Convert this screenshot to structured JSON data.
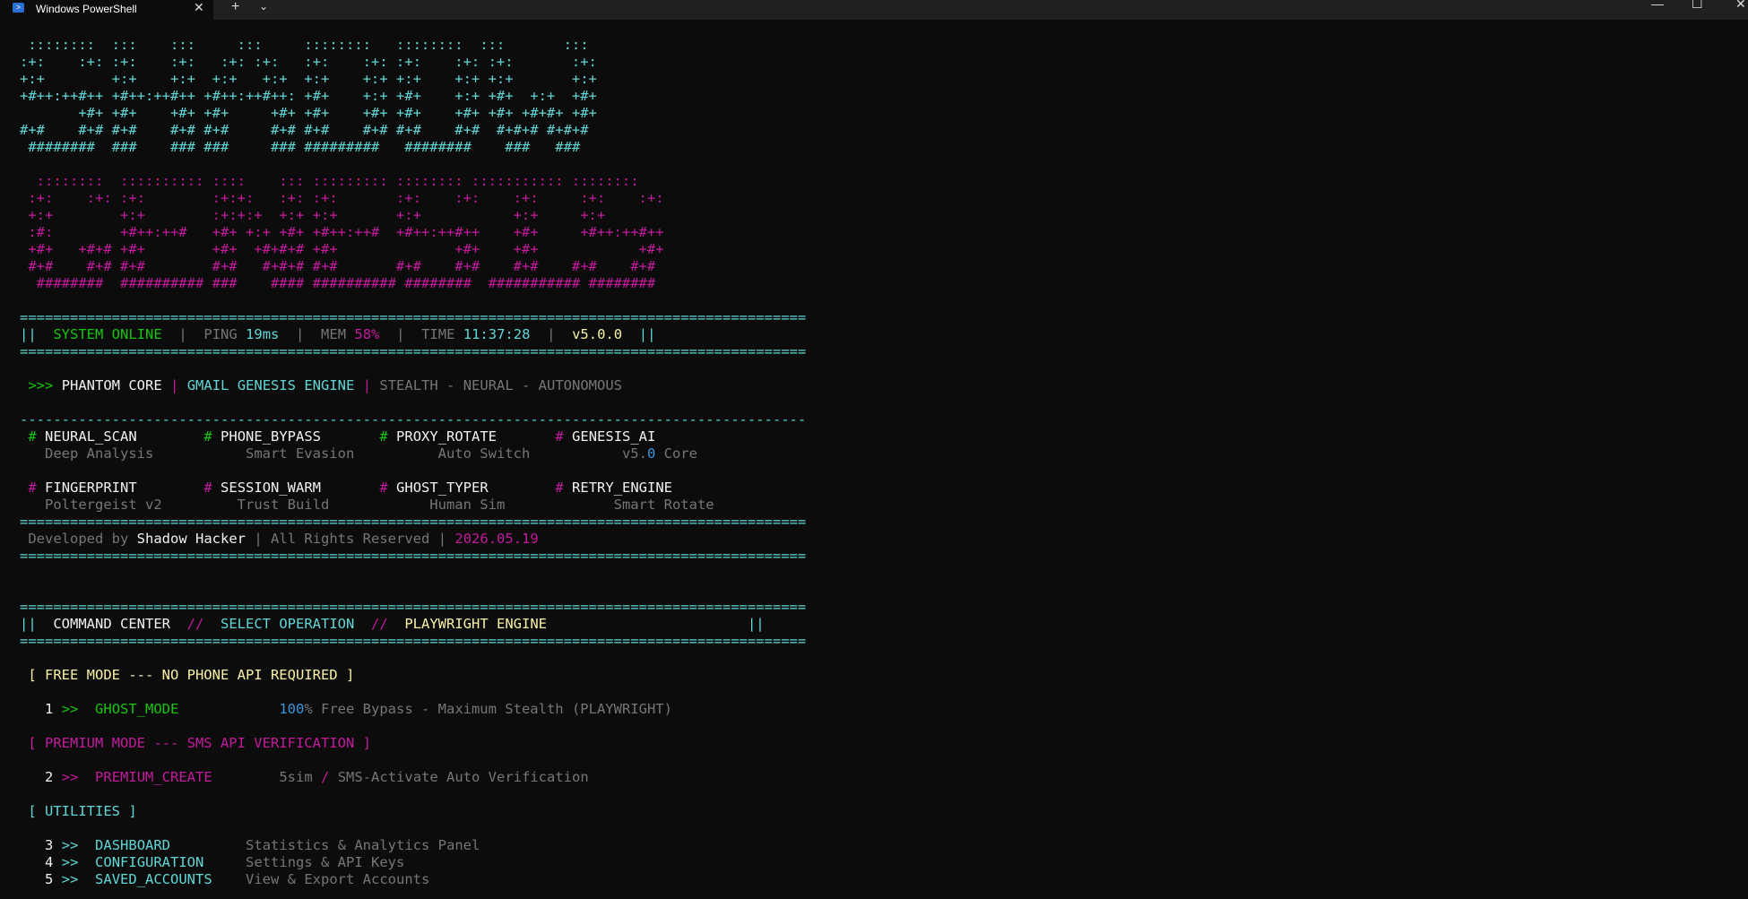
{
  "window": {
    "tab_title": "Windows PowerShell",
    "tab_close": "✕",
    "new_tab": "+",
    "tab_dropdown": "⌄",
    "minimize": "—",
    "maximize": "☐",
    "close": "✕"
  },
  "banner": {
    "ghost_lines": [
      " ::::::::  :::    :::     :::     ::::::::   ::::::::  :::       :::",
      ":+:    :+: :+:    :+:   :+: :+:   :+:    :+: :+:    :+: :+:       :+:",
      "+:+        +:+    +:+  +:+   +:+  +:+    +:+ +:+    +:+ +:+       +:+",
      "+#++:++#++ +#++:++#++ +#++:++#++: +#+    +:+ +#+    +:+ +#+  +:+  +#+",
      "       +#+ +#+    +#+ +#+     +#+ +#+    +#+ +#+    +#+ +#+ +#+#+ +#+",
      "#+#    #+# #+#    #+# #+#     #+# #+#    #+# #+#    #+#  #+#+# #+#+#",
      " ########  ###    ### ###     ### #########   ########    ###   ###"
    ],
    "genesis_lines": [
      "  ::::::::  :::::::::: ::::    ::: ::::::::: :::::::: ::::::::::: ::::::::",
      " :+:    :+: :+:        :+:+:   :+: :+:       :+:    :+:    :+:     :+:    :+:",
      " +:+        +:+        :+:+:+  +:+ +:+       +:+           +:+     +:+",
      " :#:        +#++:++#   +#+ +:+ +#+ +#++:++#  +#++:++#++    +#+     +#++:++#++",
      " +#+   +#+# +#+        +#+  +#+#+# +#+              +#+    +#+            +#+",
      " #+#    #+# #+#        #+#   #+#+# #+#       #+#    #+#    #+#    #+#    #+#",
      "  ########  ########## ###    #### ########## ########  ########### ########"
    ]
  },
  "separators": {
    "double": "==============================================================================================",
    "single": "----------------------------------------------------------------------------------------------"
  },
  "status": {
    "bars": "||",
    "pipe": "|",
    "online": "SYSTEM ONLINE",
    "ping_label": "PING",
    "ping_value": "19ms",
    "mem_label": "MEM",
    "mem_value": "58%",
    "time_label": "TIME",
    "time_value": "11:37:28",
    "version": "v5.0.0"
  },
  "header": {
    "prompt": ">>>",
    "core": "PHANTOM CORE",
    "pipe": "|",
    "engine": "GMAIL GENESIS ENGINE",
    "tagline": "STEALTH - NEURAL - AUTONOMOUS"
  },
  "features": {
    "hash": "#",
    "row1": [
      {
        "name": "NEURAL_SCAN",
        "desc": "Deep Analysis"
      },
      {
        "name": "PHONE_BYPASS",
        "desc": "Smart Evasion"
      },
      {
        "name": "PROXY_ROTATE",
        "desc": "Auto Switch"
      },
      {
        "name": "GENESIS_AI",
        "desc_pre": "v5.",
        "desc_num": "0",
        "desc_post": " Core"
      }
    ],
    "row2": [
      {
        "name": "FINGERPRINT",
        "desc": "Poltergeist v2"
      },
      {
        "name": "SESSION_WARM",
        "desc": "Trust Build"
      },
      {
        "name": "GHOST_TYPER",
        "desc": "Human Sim"
      },
      {
        "name": "RETRY_ENGINE",
        "desc": "Smart Rotate"
      }
    ]
  },
  "credits": {
    "dev_label": "Developed by",
    "author": "Shadow Hacker",
    "pipe": "|",
    "rights": "All Rights Reserved",
    "date": "2026.05.19"
  },
  "command_center": {
    "bars": "||",
    "sep": "//",
    "title": "COMMAND CENTER",
    "select": "SELECT OPERATION",
    "engine": "PLAYWRIGHT ENGINE"
  },
  "menu": {
    "arrow": ">>",
    "free_header": "[ FREE MODE --- NO PHONE API REQUIRED ]",
    "opt1": {
      "num": "1",
      "name": "GHOST_MODE",
      "desc_num": "100",
      "desc": "% Free Bypass - Maximum Stealth (PLAYWRIGHT)"
    },
    "premium_header": "[ PREMIUM MODE --- SMS API VERIFICATION ]",
    "opt2": {
      "num": "2",
      "name": "PREMIUM_CREATE",
      "desc_a": "5sim",
      "desc_sep": "/",
      "desc_b": "SMS-Activate Auto Verification"
    },
    "utilities_header": "[ UTILITIES ]",
    "utilities": [
      {
        "num": "3",
        "name": "DASHBOARD",
        "desc": "Statistics & Analytics Panel"
      },
      {
        "num": "4",
        "name": "CONFIGURATION",
        "desc": "Settings & API Keys"
      },
      {
        "num": "5",
        "name": "SAVED_ACCOUNTS",
        "desc": "View & Export Accounts"
      }
    ]
  }
}
